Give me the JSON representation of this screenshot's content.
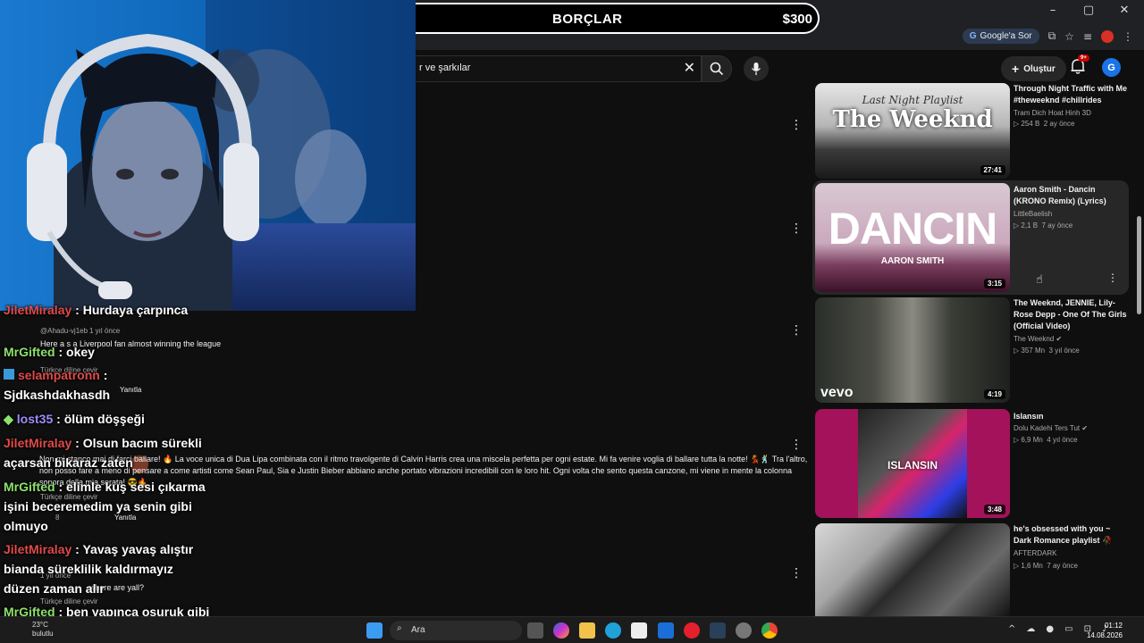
{
  "browser": {
    "google_ask_label": "Google'a Sor",
    "window_controls": [
      "–",
      "▢",
      "✕"
    ]
  },
  "overlay_banner": {
    "title": "BORÇLAR",
    "amount": "$300"
  },
  "header": {
    "search_value": "r ve şarkılar",
    "create_label": "Oluştur",
    "notifications_badge": "9+",
    "avatar_letter": "G"
  },
  "chat": [
    {
      "user": "JiletMiralay",
      "message": "Hurdaya çarpınca",
      "user_color": "#e24a4a"
    },
    {
      "user": "MrGifted",
      "message": "okey",
      "user_color": "#8de26b"
    },
    {
      "user": "selampatronn",
      "message": "Sjdkashdakhasdh",
      "user_color": "#e24a4a"
    },
    {
      "user": "lost35",
      "message": "ölüm döşşeği",
      "user_color": "#a08cff"
    },
    {
      "user": "JiletMiralay",
      "message": "Olsun bacım sürekli açarsan bikaraz zaten",
      "user_color": "#e24a4a"
    },
    {
      "user": "MrGifted",
      "message": "elimle kuş sesi çıkarma işini beceremedim ya senin gibi olmuyo",
      "user_color": "#8de26b"
    },
    {
      "user": "JiletMiralay",
      "message": "Yavaş yavaş alıştır bianda süreklilik kaldırmayız düzen zaman alır",
      "user_color": "#e24a4a"
    },
    {
      "user": "MrGifted",
      "message": "ben yapınca osuruk gibi çıkıyor",
      "user_color": "#8de26b"
    }
  ],
  "comments": {
    "c1_author": "@Ahadu-vj1eb",
    "c1_time": "1 yıl önce",
    "c1_text": "Here a s a Liverpool fan almost winning the league",
    "translate": "Türkçe diline çevir",
    "reply": "Yanıtla",
    "c2_text": "Non mi stanco mai di farci ballare! 🔥 La voce unica di Dua Lipa combinata con il ritmo travolgente di Calvin Harris crea una miscela perfetta per ogni estate. Mi fa venire voglia di ballare tutta la notte! 💃🕺 Tra l'altro, non posso fare a meno di pensare a come artisti come Sean Paul, Sia e Justin Bieber abbiano anche portato vibrazioni incredibili con le loro hit. Ogni volta che sento questa canzone, mi viene in mente la colonna sonora della mia serata! 😎🔥",
    "c2_likes": "8",
    "c3_text": "where are yall?",
    "c3_time": "1 yıl önce"
  },
  "recommendations": [
    {
      "thumb_title": "The Weeknd",
      "thumb_subtitle": "Last Night Playlist",
      "title": "Through Night Traffic with Me #theweeknd #chillrides",
      "channel": "Tram Dich Hoat Hinh 3D",
      "views": "254 B",
      "age": "2 ay önce",
      "duration": "27:41"
    },
    {
      "thumb_title": "DANCIN",
      "thumb_subtitle": "AARON SMITH",
      "title": "Aaron Smith - Dancin (KRONO Remix) (Lyrics)",
      "channel": "LittleBaelish",
      "views": "2,1 B",
      "age": "7 ay önce",
      "duration": "3:15"
    },
    {
      "thumb_title": "vevo",
      "title": "The Weeknd, JENNIE, Lily-Rose Depp - One Of The Girls (Official Video)",
      "channel": "The Weeknd",
      "views": "357 Mn",
      "age": "3 yıl önce",
      "duration": "4:19"
    },
    {
      "thumb_title": "ISLANSIN",
      "title": "Islansın",
      "channel": "Dolu Kadehi Ters Tut",
      "views": "6,9 Mn",
      "age": "4 yıl önce",
      "duration": "3:48"
    },
    {
      "title": "he's obsessed with you ~ Dark Romance playlist 🥀",
      "channel": "AFTERDARK",
      "views": "1,6 Mn",
      "age": "7 ay önce"
    }
  ],
  "taskbar": {
    "search_placeholder": "Ara",
    "weather_temp": "23°C",
    "weather_desc": "bulutlu",
    "time": "01:12",
    "date": "14.08.2026"
  }
}
